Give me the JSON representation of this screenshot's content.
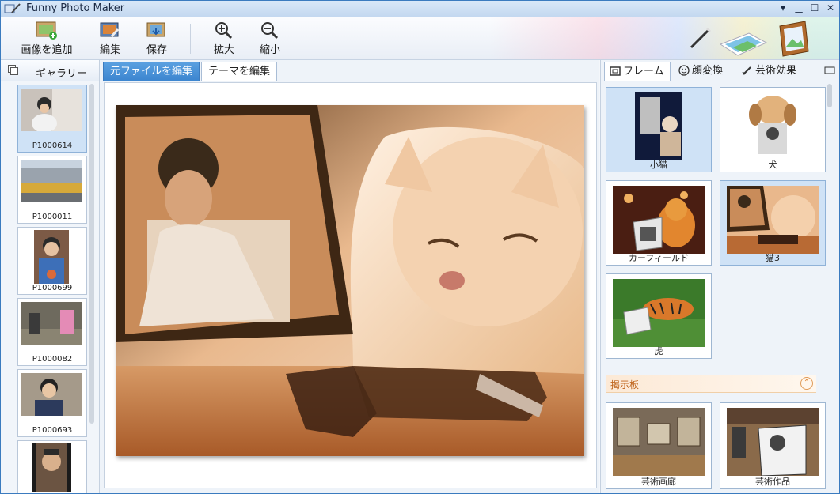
{
  "window": {
    "title": "Funny Photo Maker"
  },
  "toolbar": {
    "add_image": "画像を追加",
    "edit": "編集",
    "save": "保存",
    "zoom_in": "拡大",
    "zoom_out": "縮小"
  },
  "gallery": {
    "title": "ギャラリー",
    "items": [
      {
        "label": "P1000614"
      },
      {
        "label": "P1000011"
      },
      {
        "label": "P1000699"
      },
      {
        "label": "P1000082"
      },
      {
        "label": "P1000693"
      }
    ]
  },
  "editor": {
    "tabs": [
      {
        "label": "元ファイルを編集"
      },
      {
        "label": "テーマを編集"
      }
    ],
    "active_tab": 0
  },
  "right_panel": {
    "tabs": [
      {
        "label": "フレーム",
        "icon": "frame-icon"
      },
      {
        "label": "顔変換",
        "icon": "smiley-icon"
      },
      {
        "label": "芸術効果",
        "icon": "brush-icon"
      }
    ],
    "frames": [
      {
        "label": "小猫"
      },
      {
        "label": "犬"
      },
      {
        "label": "カーフィールド"
      },
      {
        "label": "猫3"
      },
      {
        "label": "虎"
      }
    ],
    "section": {
      "title": "掲示板"
    },
    "board_items": [
      {
        "label": "芸術画廊"
      },
      {
        "label": "芸術作品"
      }
    ]
  },
  "colors": {
    "accent": "#3b84cf",
    "section": "#c0661e"
  }
}
